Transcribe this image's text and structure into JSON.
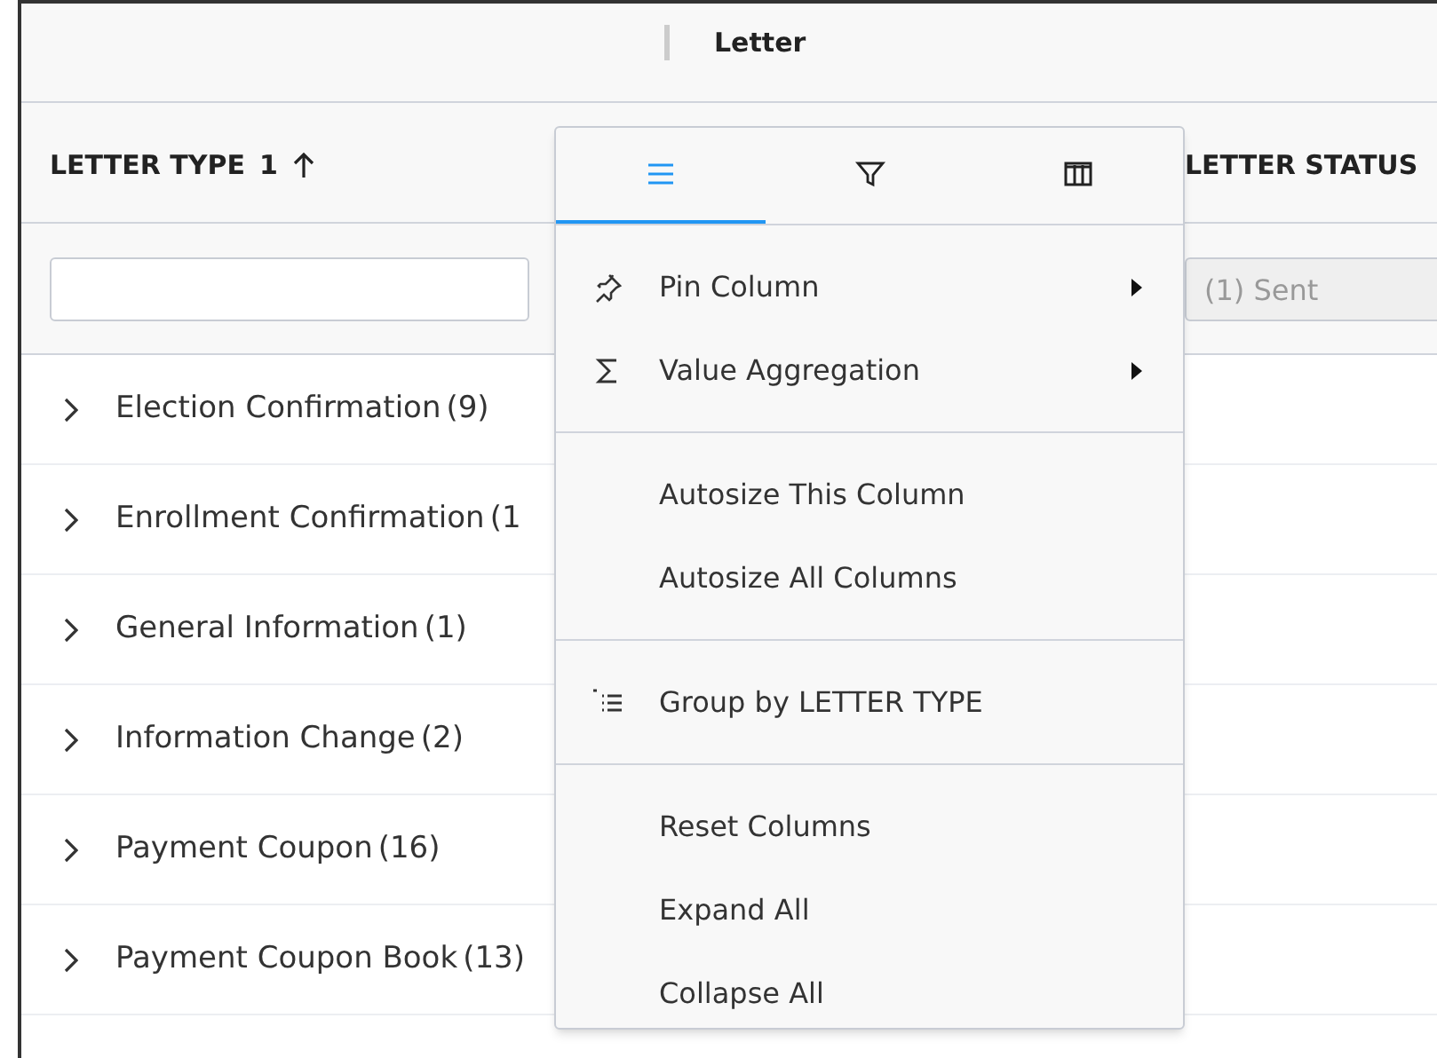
{
  "group_header": {
    "label": "Letter"
  },
  "columns": [
    {
      "label": "LETTER TYPE",
      "sort_index": "1",
      "sorted": true
    },
    {
      "label": "LETTER STATUS",
      "sorted": false
    }
  ],
  "filters": [
    {
      "kind": "text"
    },
    {
      "kind": "set",
      "value": "(1) Sent"
    }
  ],
  "rows": [
    {
      "label": "Election Confirmation",
      "count": "(9)"
    },
    {
      "label": "Enrollment Confirmation",
      "count": "(1"
    },
    {
      "label": "General Information",
      "count": "(1)"
    },
    {
      "label": "Information Change",
      "count": "(2)"
    },
    {
      "label": "Payment Coupon",
      "count": "(16)"
    },
    {
      "label": "Payment Coupon Book",
      "count": "(13)"
    }
  ],
  "column_menu": {
    "tabs": [
      {
        "kind": "general",
        "selected": true
      },
      {
        "kind": "filter",
        "selected": false
      },
      {
        "kind": "columns",
        "selected": false
      }
    ],
    "sections": [
      [
        {
          "label": "Pin Column",
          "kind": "pin",
          "submenu": true
        },
        {
          "label": "Value Aggregation",
          "kind": "aggregation",
          "submenu": true
        }
      ],
      [
        {
          "label": "Autosize This Column",
          "submenu": false
        },
        {
          "label": "Autosize All Columns",
          "submenu": false
        }
      ],
      [
        {
          "label": "Group by LETTER TYPE",
          "kind": "group",
          "submenu": false
        }
      ],
      [
        {
          "label": "Reset Columns",
          "submenu": false
        },
        {
          "label": "Expand All",
          "submenu": false
        },
        {
          "label": "Collapse All",
          "submenu": false
        }
      ]
    ]
  }
}
